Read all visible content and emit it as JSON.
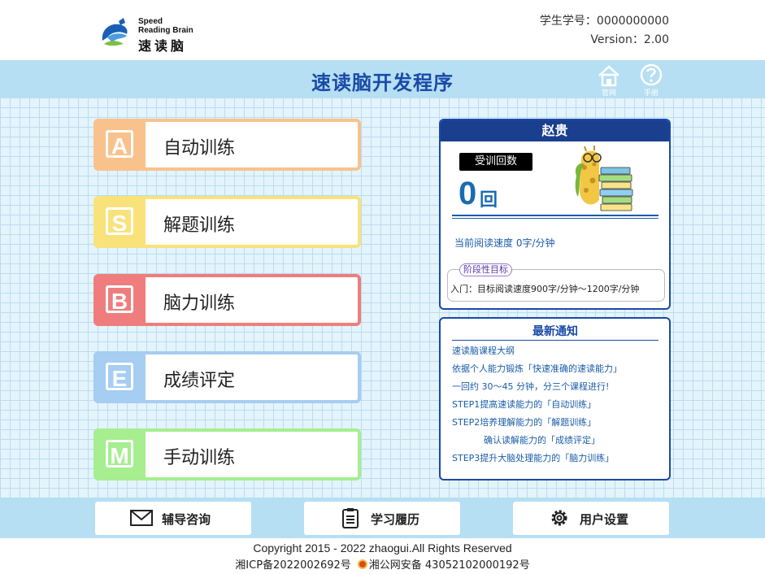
{
  "header": {
    "logo_en_line1": "Speed",
    "logo_en_line2": "Reading Brain",
    "logo_cn": "速读脑",
    "student_id": "学生学号：0000000000",
    "version": "Version：2.00"
  },
  "title_band": {
    "title": "速读脑开发程序",
    "home_caption": "官网",
    "help_caption": "手册"
  },
  "menu": [
    {
      "letter": "A",
      "label": "自动训练",
      "color": "#f9c28c",
      "icon": "letter-a-icon"
    },
    {
      "letter": "S",
      "label": "解题训练",
      "color": "#f9e27a",
      "icon": "letter-s-icon"
    },
    {
      "letter": "B",
      "label": "脑力训练",
      "color": "#f07d7d",
      "icon": "letter-b-icon"
    },
    {
      "letter": "E",
      "label": "成绩评定",
      "color": "#a6cdf2",
      "icon": "letter-e-icon"
    },
    {
      "letter": "M",
      "label": "手动训练",
      "color": "#a6ee90",
      "icon": "letter-m-icon"
    }
  ],
  "profile": {
    "name": "赵贵",
    "count_tag": "受训回数",
    "count_value": "0",
    "count_unit": "回",
    "speed_text": "当前阅读速度 0字/分钟",
    "goal_tag": "阶段性目标",
    "goal_text": "入门：目标阅读速度900字/分钟～1200字/分钟"
  },
  "news": {
    "title": "最新通知",
    "items": [
      "速读脑课程大纲",
      "依据个人能力锻炼「快速准确的速读能力」",
      "一回约 30～45 分钟，分三个课程进行!",
      "STEP1提高速读能力的「自动训练」",
      "STEP2培养理解能力的「解题训练」",
      "确认读解能力的「成绩评定」",
      "STEP3提升大脑处理能力的「脑力训练」"
    ]
  },
  "bottom": {
    "consult": "辅导咨询",
    "history": "学习履历",
    "settings": "用户设置"
  },
  "footer": {
    "copyright": "Copyright 2015 - 2022  zhaogui.All Rights Reserved",
    "icp": "湘ICP备2022002692号",
    "police": "湘公网安备 43052102000192号"
  },
  "colors": {
    "accent": "#1a4aa8",
    "band": "#b6dff3",
    "grid_bg": "#e3f4fc"
  }
}
